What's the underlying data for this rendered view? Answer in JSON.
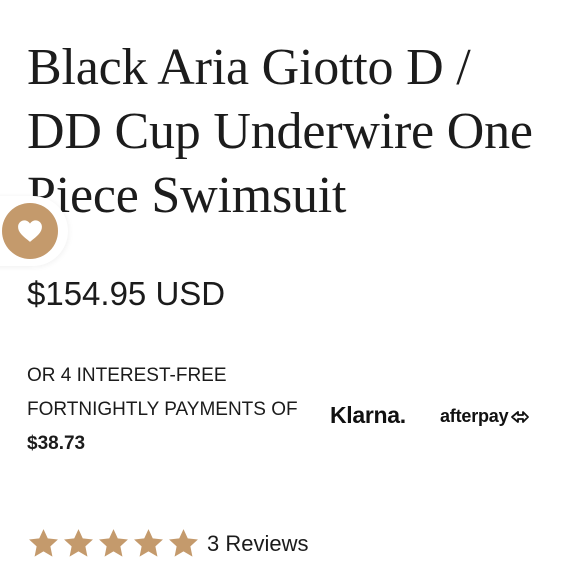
{
  "product": {
    "title": "Black Aria Giotto D / DD Cup Underwire One Piece Swimsuit",
    "price": "$154.95 USD"
  },
  "installments": {
    "line1": "OR 4 INTEREST-FREE",
    "line2": "FORTNIGHTLY PAYMENTS OF",
    "amount": "$38.73",
    "providers": [
      {
        "name": "Klarna.",
        "icon": "klarna-logo"
      },
      {
        "name": "afterpay",
        "icon": "afterpay-arrows-icon"
      }
    ]
  },
  "rating": {
    "value": 5,
    "max": 5,
    "reviews_label": "3 Reviews"
  },
  "wishlist": {
    "icon": "heart-icon"
  },
  "colors": {
    "accent": "#c49a6c",
    "text": "#1b1b1b",
    "background": "#ffffff"
  }
}
